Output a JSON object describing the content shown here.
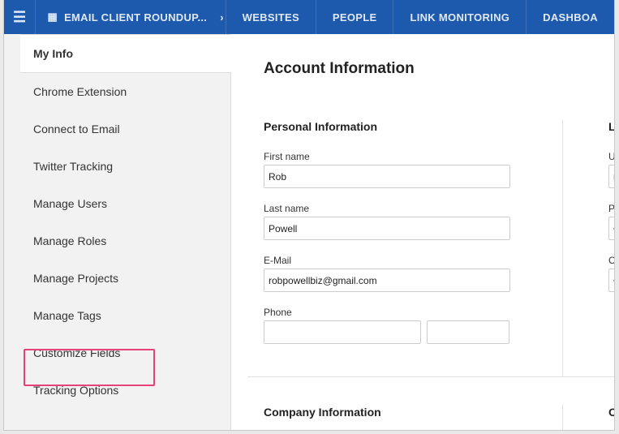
{
  "topbar": {
    "project": "EMAIL CLIENT ROUNDUP...",
    "nav": [
      "WEBSITES",
      "PEOPLE",
      "LINK MONITORING",
      "DASHBOA"
    ]
  },
  "sidebar": {
    "items": [
      "My Info",
      "Chrome Extension",
      "Connect to Email",
      "Twitter Tracking",
      "Manage Users",
      "Manage Roles",
      "Manage Projects",
      "Manage Tags",
      "Customize Fields",
      "Tracking Options"
    ]
  },
  "main": {
    "title": "Account Information",
    "personal": {
      "heading": "Personal Information",
      "first_label": "First name",
      "first": "Rob",
      "last_label": "Last name",
      "last": "Powell",
      "email_label": "E-Mail",
      "email": "robpowellbiz@gmail.com",
      "phone_label": "Phone"
    },
    "login": {
      "heading": "Lo",
      "user_label": "Us",
      "user": "r",
      "pass_label": "Pa",
      "pass": "•",
      "confirm_label": "Co",
      "confirm": "•"
    },
    "company_heading": "Company Information",
    "other_heading": "O"
  },
  "colors": {
    "nav": "#1d5aad",
    "highlight": "#e8417a"
  }
}
